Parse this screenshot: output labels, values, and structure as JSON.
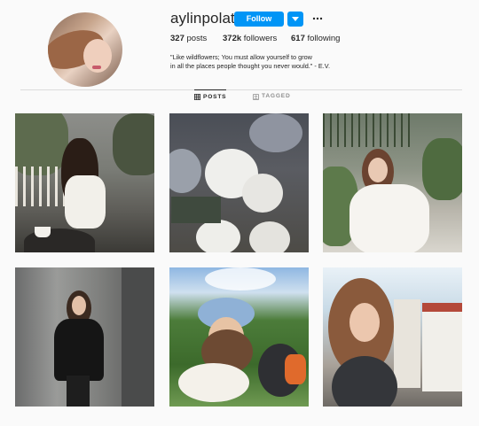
{
  "profile": {
    "username": "aylinpolat",
    "follow_label": "Follow",
    "posts_count": "327",
    "posts_label": "posts",
    "followers_count": "372k",
    "followers_label": "followers",
    "following_count": "617",
    "following_label": "following",
    "bio_line1": "\"Like wildflowers; You must allow yourself to grow",
    "bio_line2": "in all the places people thought you never would.\" - E.V."
  },
  "tabs": [
    {
      "label": "POSTS",
      "icon": "grid-icon",
      "active": true
    },
    {
      "label": "TAGGED",
      "icon": "tag-icon",
      "active": false
    }
  ],
  "colors": {
    "accent": "#0095f6",
    "text": "#262626",
    "muted": "#8e8e8e",
    "background": "#fafafa",
    "divider": "#dbdbdb"
  },
  "posts": [
    {
      "description": "woman in white top at outdoor cafe"
    },
    {
      "description": "white hydrangea flowers at market stall"
    },
    {
      "description": "woman in white lace dress on balcony with plants"
    },
    {
      "description": "woman in black outfit taking mirror selfie in elevator"
    },
    {
      "description": "woman in blue bucket hat with dog on grass"
    },
    {
      "description": "woman in tank top on balcony with city view"
    }
  ]
}
